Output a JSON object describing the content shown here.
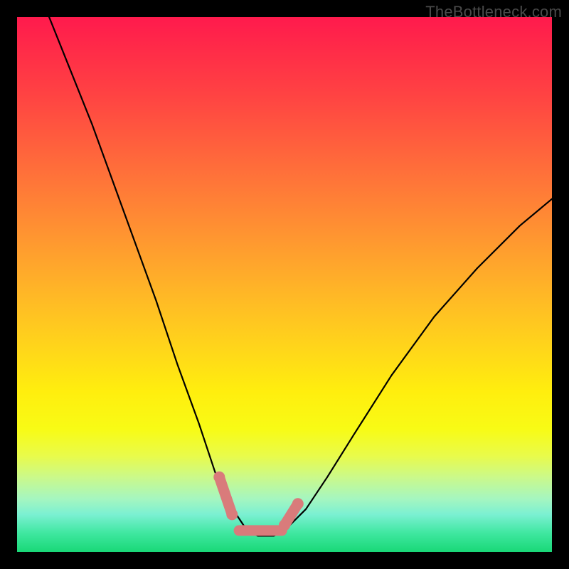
{
  "watermark": "TheBottleneck.com",
  "colors": {
    "curve": "#000000",
    "accent": "#d97b7b",
    "frame": "#000000"
  },
  "chart_data": {
    "type": "line",
    "title": "",
    "xlabel": "",
    "ylabel": "",
    "xlim": [
      0,
      100
    ],
    "ylim": [
      0,
      100
    ],
    "grid": false,
    "legend": false,
    "series": [
      {
        "name": "bottleneck-curve",
        "x": [
          6,
          10,
          14,
          18,
          22,
          26,
          30,
          34,
          37,
          39,
          41,
          43,
          45,
          48,
          50,
          54,
          58,
          63,
          70,
          78,
          86,
          94,
          100
        ],
        "values": [
          100,
          90,
          80,
          69,
          58,
          47,
          35,
          24,
          15,
          10,
          7,
          4,
          3,
          3,
          4,
          8,
          14,
          22,
          33,
          44,
          53,
          61,
          66
        ]
      }
    ],
    "annotations": [
      {
        "name": "left-marker-upper",
        "x": 37.8,
        "y": 14.0
      },
      {
        "name": "left-marker-lower",
        "x": 40.2,
        "y": 7.0
      },
      {
        "name": "flat-segment-start",
        "x": 41.5,
        "y": 4.0
      },
      {
        "name": "flat-segment-end",
        "x": 49.5,
        "y": 4.0
      },
      {
        "name": "right-marker-lower",
        "x": 50.0,
        "y": 5.0
      },
      {
        "name": "right-marker-upper",
        "x": 52.5,
        "y": 9.0
      }
    ]
  }
}
